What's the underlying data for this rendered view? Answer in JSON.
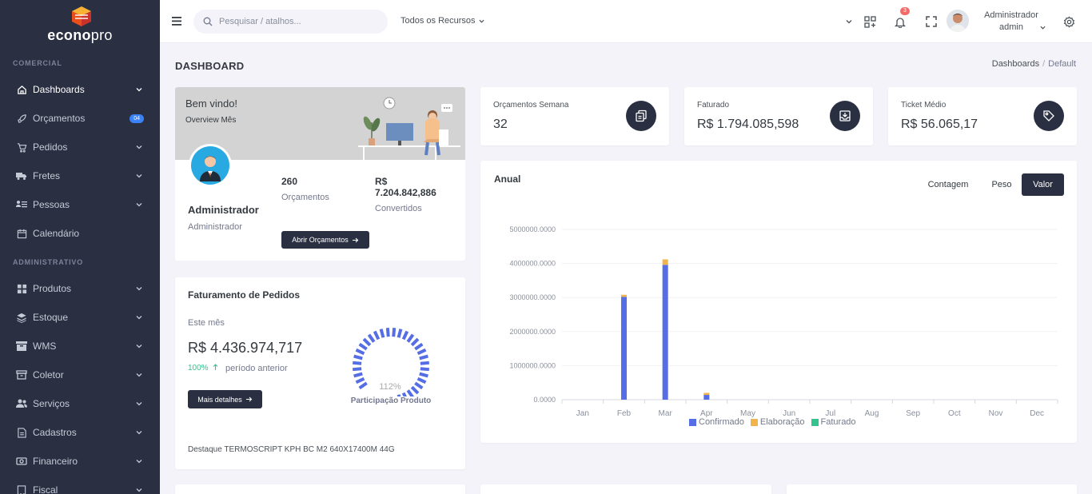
{
  "brand": {
    "name_bold": "econo",
    "name_light": "pro"
  },
  "sidebar": {
    "sections": [
      {
        "title": "COMERCIAL"
      },
      {
        "title": "ADMINISTRATIVO"
      }
    ],
    "items": [
      {
        "label": "Dashboards",
        "icon": "home-icon",
        "active": true
      },
      {
        "label": "Orçamentos",
        "icon": "rocket-icon",
        "badge": "04"
      },
      {
        "label": "Pedidos",
        "icon": "cart-icon"
      },
      {
        "label": "Fretes",
        "icon": "truck-icon"
      },
      {
        "label": "Pessoas",
        "icon": "people-list-icon"
      },
      {
        "label": "Calendário",
        "icon": "calendar-icon"
      },
      {
        "label": "Produtos",
        "icon": "grid-icon"
      },
      {
        "label": "Estoque",
        "icon": "layers-icon"
      },
      {
        "label": "WMS",
        "icon": "box-icon"
      },
      {
        "label": "Coletor",
        "icon": "archive-icon"
      },
      {
        "label": "Serviços",
        "icon": "users-icon"
      },
      {
        "label": "Cadastros",
        "icon": "file-icon"
      },
      {
        "label": "Financeiro",
        "icon": "money-icon"
      },
      {
        "label": "Fiscal",
        "icon": "receipt-icon"
      }
    ]
  },
  "topbar": {
    "search_placeholder": "Pesquisar / atalhos...",
    "resources": "Todos os Recursos",
    "notifications": "3",
    "user_name": "Administrador",
    "user_login": "admin"
  },
  "page": {
    "title": "DASHBOARD",
    "breadcrumb": [
      "Dashboards",
      "Default"
    ]
  },
  "welcome": {
    "title": "Bem vindo!",
    "subtitle": "Overview Mês",
    "name": "Administrador",
    "role": "Administrador",
    "stat1_value": "260",
    "stat1_label": "Orçamentos",
    "stat2_value_line1": "R$",
    "stat2_value_line2": "7.204.842,886",
    "stat2_label": "Convertidos",
    "button": "Abrir Orçamentos"
  },
  "faturamento": {
    "title": "Faturamento de Pedidos",
    "period": "Este mês",
    "value": "R$ 4.436.974,717",
    "change": "100%",
    "change_label": "período anterior",
    "button": "Mais detalhes",
    "gauge_value": "112%",
    "gauge_label": "Participação Produto",
    "gauge_fill": 1.0,
    "destaque": "Destaque TERMOSCRIPT KPH BC M2 640X17400M 44G"
  },
  "stats": [
    {
      "label": "Orçamentos Semana",
      "value": "32",
      "icon": "copy-icon"
    },
    {
      "label": "Faturado",
      "value": "R$ 1.794.085,598",
      "icon": "archive-download-icon"
    },
    {
      "label": "Ticket Médio",
      "value": "R$ 56.065,17",
      "icon": "tag-icon"
    }
  ],
  "anual": {
    "title": "Anual",
    "tabs": [
      {
        "label": "Contagem",
        "active": false
      },
      {
        "label": "Peso",
        "active": false
      },
      {
        "label": "Valor",
        "active": true
      }
    ]
  },
  "colors": {
    "sidebar": "#2a3042",
    "confirmado": "#556ee6",
    "elaboracao": "#f1b44c",
    "faturado": "#34c38f"
  },
  "chart_data": {
    "type": "bar",
    "stacked": true,
    "categories": [
      "Jan",
      "Feb",
      "Mar",
      "Apr",
      "May",
      "Jun",
      "Jul",
      "Aug",
      "Sep",
      "Oct",
      "Nov",
      "Dec"
    ],
    "ylim": [
      0,
      5000000
    ],
    "yticks": [
      "0.0000",
      "1000000.0000",
      "2000000.0000",
      "3000000.0000",
      "4000000.0000",
      "5000000.0000"
    ],
    "series": [
      {
        "name": "Confirmado",
        "color": "#556ee6",
        "values": [
          0,
          3020000,
          3960000,
          140000,
          0,
          0,
          0,
          0,
          0,
          0,
          0,
          0
        ]
      },
      {
        "name": "Elaboração",
        "color": "#f1b44c",
        "values": [
          0,
          60000,
          160000,
          60000,
          0,
          0,
          0,
          0,
          0,
          0,
          0,
          0
        ]
      },
      {
        "name": "Faturado",
        "color": "#34c38f",
        "values": [
          0,
          0,
          0,
          0,
          0,
          0,
          0,
          0,
          0,
          0,
          0,
          0
        ]
      }
    ],
    "grid": true,
    "legend": "bottom"
  }
}
